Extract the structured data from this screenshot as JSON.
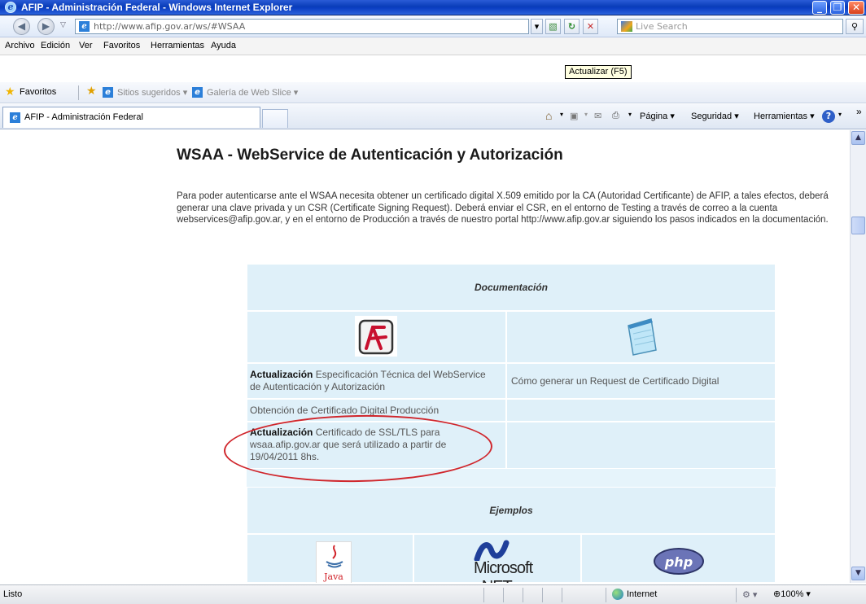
{
  "window": {
    "title": "AFIP - Administración Federal - Windows Internet Explorer"
  },
  "address": {
    "url": "http://www.afip.gov.ar/ws/#WSAA",
    "search_placeholder": "Live Search"
  },
  "menu": [
    "Archivo",
    "Edición",
    "Ver",
    "Favoritos",
    "Herramientas",
    "Ayuda"
  ],
  "tooltip": "Actualizar (F5)",
  "favorites": {
    "label": "Favoritos",
    "items": [
      "Sitios sugeridos",
      "Galería de Web Slice"
    ]
  },
  "tab": {
    "label": "AFIP - Administración Federal"
  },
  "commands": [
    "Página",
    "Seguridad",
    "Herramientas"
  ],
  "page": {
    "title": "WSAA - WebService de Autenticación y Autorización",
    "intro": "Para poder autenticarse ante el WSAA necesita obtener un certificado digital X.509 emitido por la CA (Autoridad Certificante) de AFIP, a tales efectos, deberá generar una clave privada y un CSR (Certificate Signing Request). Deberá enviar el CSR, en el entorno de Testing a través de correo a la cuenta webservices@afip.gov.ar, y en el entorno de Producción a través de nuestro portal http://www.afip.gov.ar siguiendo los pasos indicados en la documentación.",
    "doc_header": "Documentación",
    "doc_rows": [
      {
        "left_bold": "Actualización",
        "left_text": "Especificación Técnica del WebService de Autenticación y Autorización",
        "right_text": "Cómo generar un Request de Certificado Digital"
      },
      {
        "left_text": "Obtención de Certificado Digital Producción",
        "right_text": ""
      },
      {
        "left_bold": "Actualización",
        "left_text": "Certificado de SSL/TLS para wsaa.afip.gov.ar que será utilizado a partir de 19/04/2011 8hs.",
        "right_text": ""
      }
    ],
    "examples_header": "Ejemplos",
    "example_logos": [
      "Java",
      "Microsoft .NET",
      "php"
    ]
  },
  "status": {
    "text": "Listo",
    "zone": "Internet",
    "zoom": "100%"
  }
}
